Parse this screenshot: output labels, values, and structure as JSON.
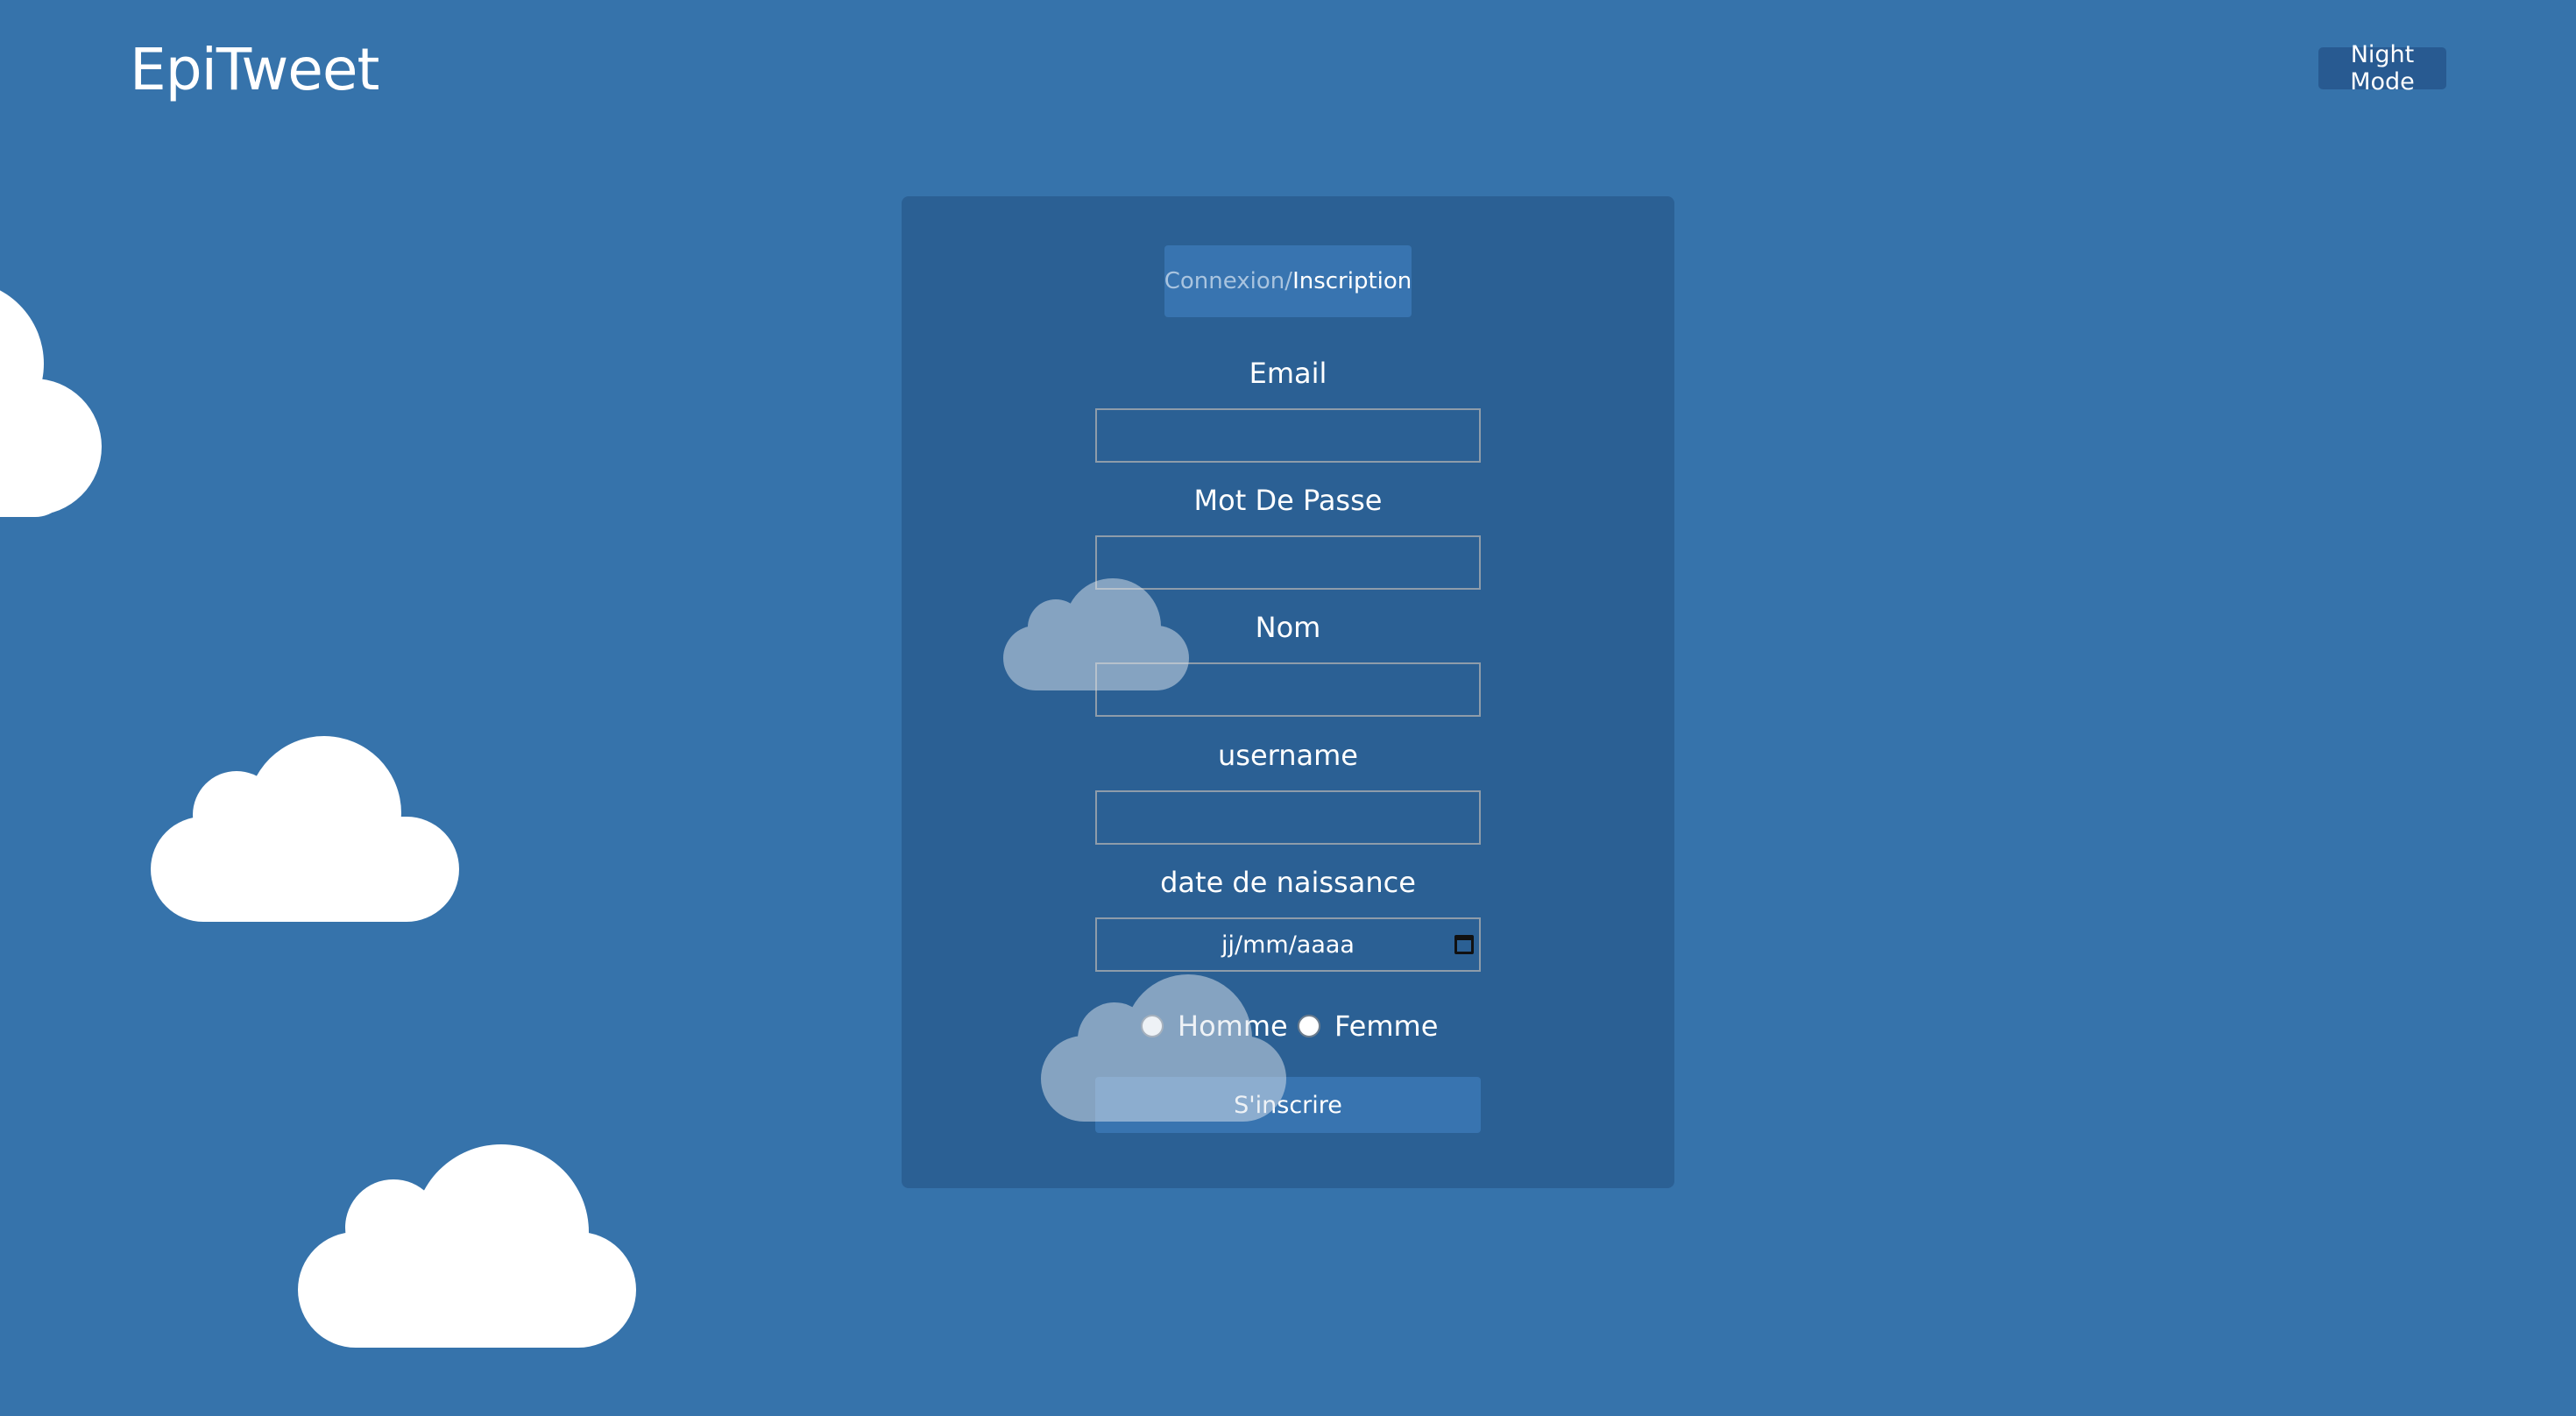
{
  "header": {
    "logo": "EpiTweet",
    "night_mode_label": "Night Mode"
  },
  "auth_tabs": {
    "login": "Connexion/",
    "register": "Inscription"
  },
  "form": {
    "email_label": "Email",
    "password_label": "Mot De Passe",
    "name_label": "Nom",
    "username_label": "username",
    "birthdate_label": "date de naissance",
    "birthdate_placeholder": "jj/mm/aaaa",
    "gender_male": "Homme",
    "gender_female": "Femme",
    "submit_label": "S'inscrire"
  },
  "colors": {
    "background": "#3673ab",
    "panel": "#2b6094",
    "button": "#3874b0",
    "night_button": "#285a91"
  }
}
